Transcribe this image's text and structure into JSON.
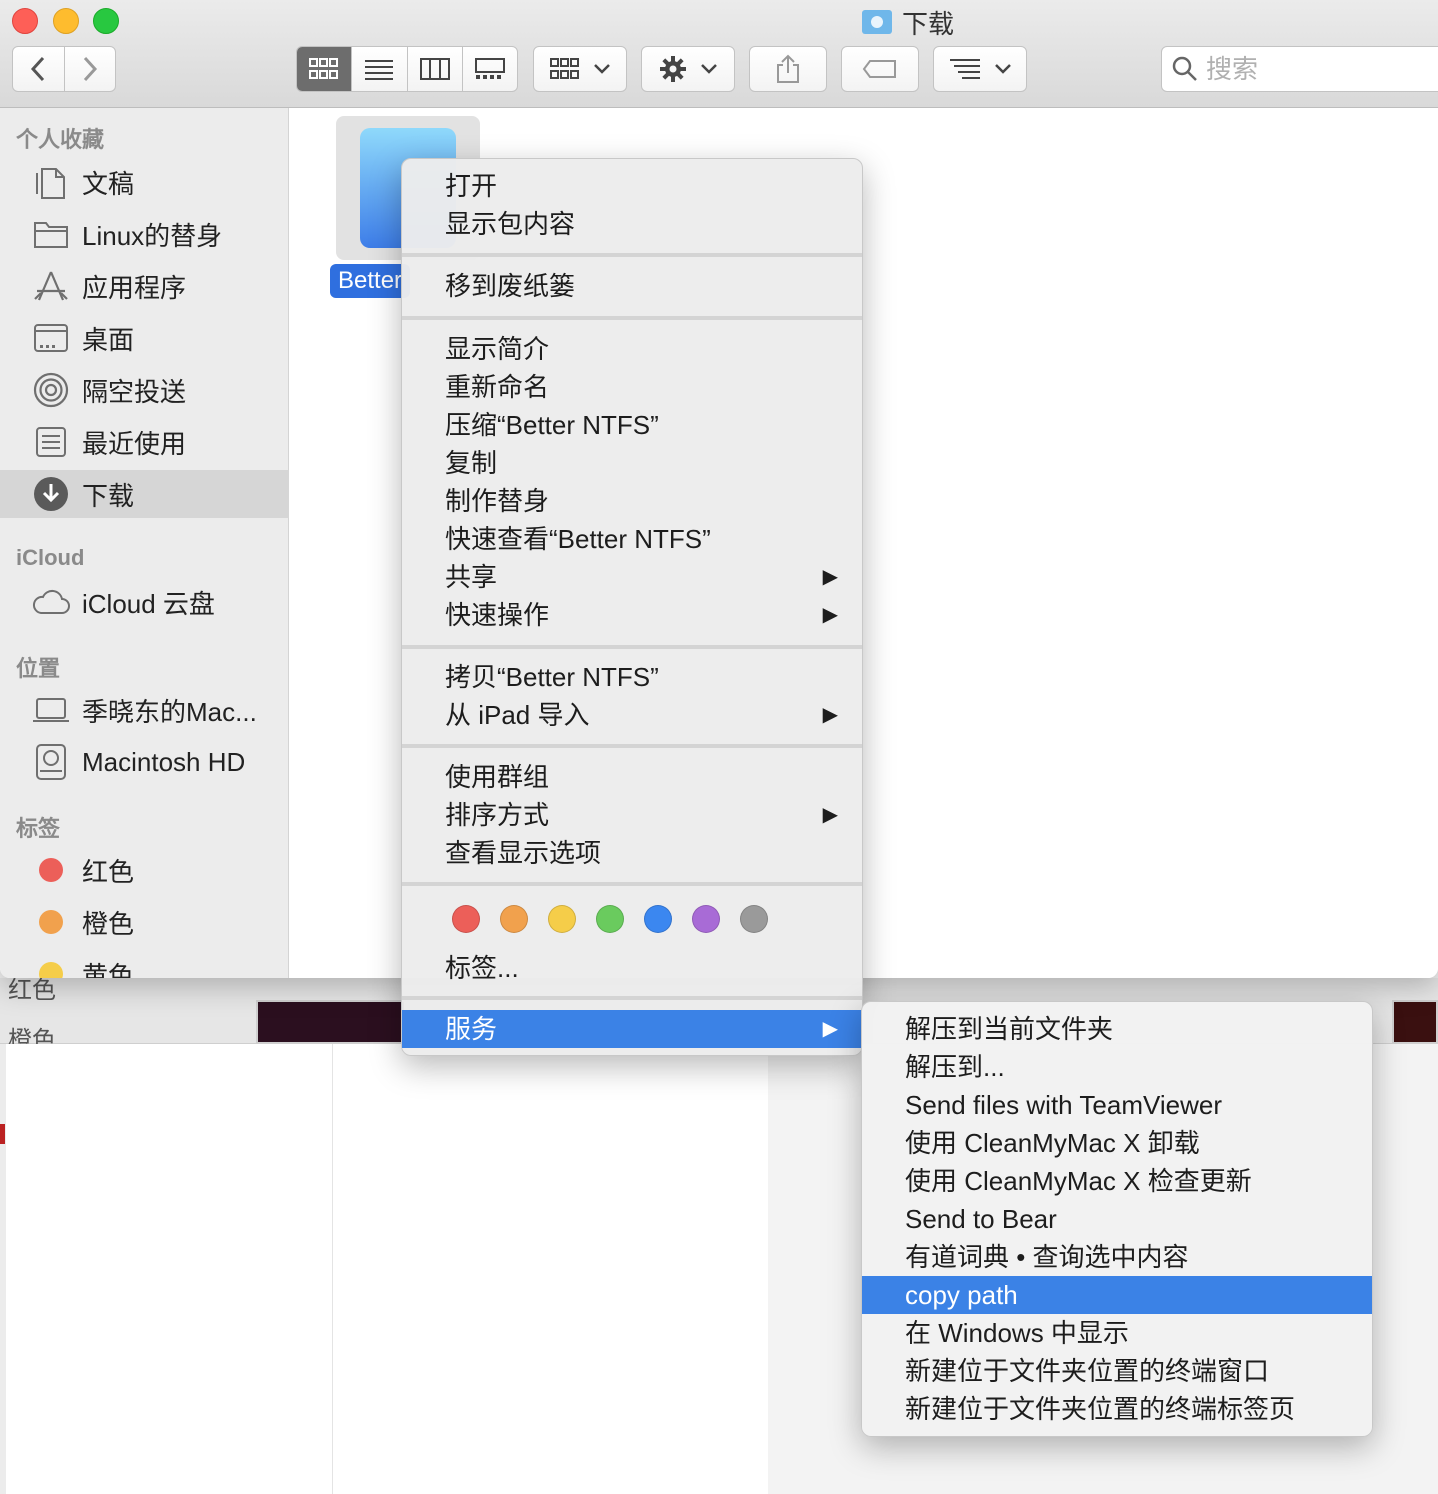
{
  "window": {
    "title": "下载"
  },
  "search": {
    "placeholder": "搜索"
  },
  "sidebar": {
    "favorites_header": "个人收藏",
    "favorites": [
      {
        "label": "文稿",
        "icon": "document-icon"
      },
      {
        "label": "Linux的替身",
        "icon": "folder-icon"
      },
      {
        "label": "应用程序",
        "icon": "applications-icon"
      },
      {
        "label": "桌面",
        "icon": "desktop-icon"
      },
      {
        "label": "隔空投送",
        "icon": "airdrop-icon"
      },
      {
        "label": "最近使用",
        "icon": "recents-icon"
      },
      {
        "label": "下载",
        "icon": "downloads-icon",
        "selected": true
      }
    ],
    "icloud_header": "iCloud",
    "icloud": [
      {
        "label": "iCloud 云盘",
        "icon": "cloud-icon"
      }
    ],
    "locations_header": "位置",
    "locations": [
      {
        "label": "季晓东的Mac...",
        "icon": "laptop-icon"
      },
      {
        "label": "Macintosh HD",
        "icon": "harddisk-icon"
      }
    ],
    "tags_header": "标签",
    "tags": [
      {
        "label": "红色",
        "color": "#ec5f59"
      },
      {
        "label": "橙色",
        "color": "#f1a14d"
      },
      {
        "label": "黄色",
        "color": "#f5cd49"
      }
    ]
  },
  "file": {
    "label": "Better"
  },
  "context_menu": {
    "groups": [
      [
        {
          "label": "打开"
        },
        {
          "label": "显示包内容"
        }
      ],
      [
        {
          "label": "移到废纸篓"
        }
      ],
      [
        {
          "label": "显示简介"
        },
        {
          "label": "重新命名"
        },
        {
          "label": "压缩“Better NTFS”"
        },
        {
          "label": "复制"
        },
        {
          "label": "制作替身"
        },
        {
          "label": "快速查看“Better NTFS”"
        },
        {
          "label": "共享",
          "submenu": true
        },
        {
          "label": "快速操作",
          "submenu": true
        }
      ],
      [
        {
          "label": "拷贝“Better NTFS”"
        },
        {
          "label": "从 iPad 导入",
          "submenu": true
        }
      ],
      [
        {
          "label": "使用群组"
        },
        {
          "label": "排序方式",
          "submenu": true
        },
        {
          "label": "查看显示选项"
        }
      ]
    ],
    "tag_colors": [
      "#ec5f59",
      "#f1a14d",
      "#f5cd49",
      "#6acb5e",
      "#3b87f0",
      "#a86bd6",
      "#9a9a9a"
    ],
    "tags_label": "标签...",
    "services_label": "服务",
    "submenu_arrow": "▶"
  },
  "services_submenu": {
    "items": [
      {
        "label": "解压到当前文件夹"
      },
      {
        "label": "解压到..."
      },
      {
        "label": "Send files with TeamViewer"
      },
      {
        "label": "使用 CleanMyMac X 卸载"
      },
      {
        "label": "使用 CleanMyMac X 检查更新"
      },
      {
        "label": "Send to Bear"
      },
      {
        "label": "有道词典 • 查询选中内容"
      },
      {
        "label": "copy path",
        "highlighted": true
      },
      {
        "label": "在 Windows 中显示"
      },
      {
        "label": "新建位于文件夹位置的终端窗口"
      },
      {
        "label": "新建位于文件夹位置的终端标签页"
      }
    ]
  },
  "background_window": {
    "labels": [
      "红色",
      "橙色"
    ]
  }
}
